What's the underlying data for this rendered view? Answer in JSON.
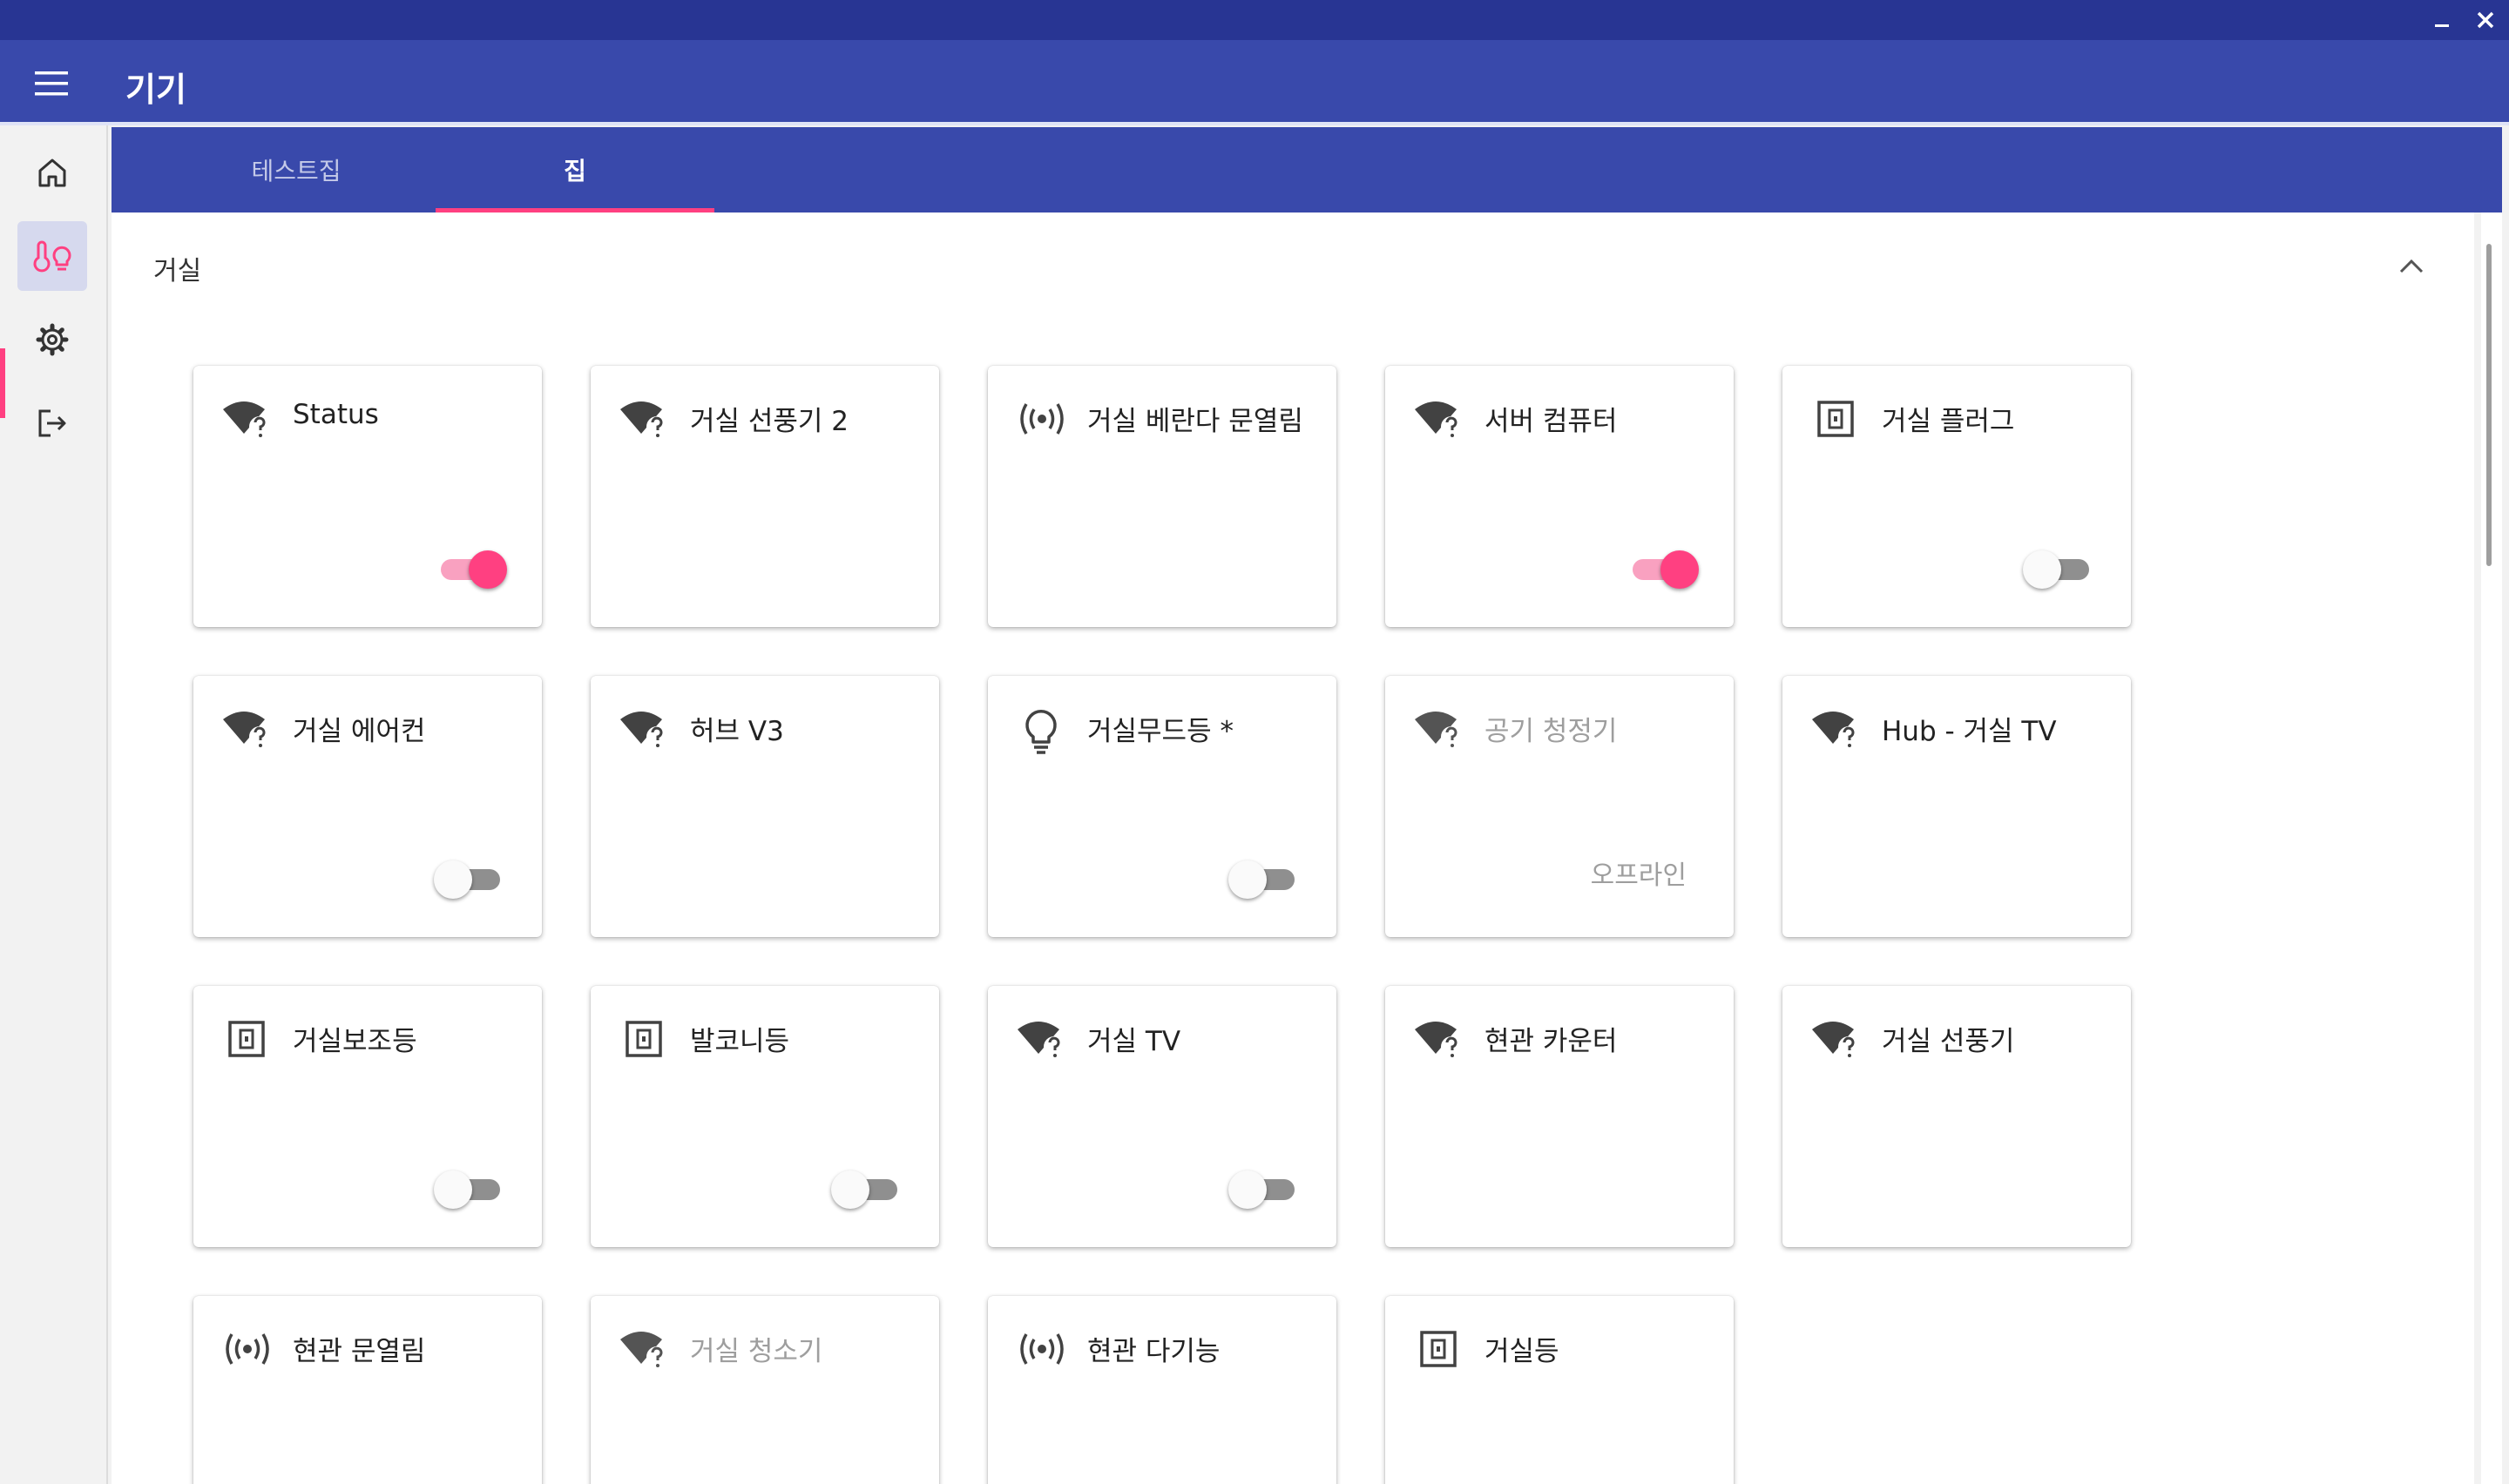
{
  "window": {
    "minimize_icon": "minimize-icon",
    "close_icon": "close-icon"
  },
  "appbar": {
    "title": "기기",
    "menu_icon": "menu-icon"
  },
  "sidebar": {
    "items": [
      {
        "icon": "home-icon"
      },
      {
        "icon": "thermometer-bulb-icon",
        "active": true
      },
      {
        "icon": "gear-icon"
      },
      {
        "icon": "logout-icon"
      }
    ]
  },
  "tabs": [
    {
      "label": "테스트집"
    },
    {
      "label": "집",
      "active": true
    }
  ],
  "section": {
    "title": "거실",
    "collapse_icon": "chevron-up-icon"
  },
  "colors": {
    "primary": "#3949ab",
    "primary_dark": "#283593",
    "accent": "#ff4081"
  },
  "devices": [
    {
      "name": "Status",
      "icon": "wifi-question-icon",
      "toggle": "on"
    },
    {
      "name": "거실 선풍기 2",
      "icon": "wifi-question-icon"
    },
    {
      "name": "거실 베란다 문열림",
      "icon": "sensor-icon"
    },
    {
      "name": "서버 컴퓨터",
      "icon": "wifi-question-icon",
      "toggle": "on"
    },
    {
      "name": "거실 플러그",
      "icon": "outlet-icon",
      "toggle": "off"
    },
    {
      "name": "거실 에어컨",
      "icon": "wifi-question-icon",
      "toggle": "off"
    },
    {
      "name": "허브 V3",
      "icon": "wifi-question-icon"
    },
    {
      "name": "거실무드등 *",
      "icon": "bulb-icon",
      "toggle": "off"
    },
    {
      "name": "공기 청정기",
      "icon": "wifi-question-icon",
      "offline": true,
      "status": "오프라인"
    },
    {
      "name": "Hub - 거실 TV",
      "icon": "wifi-question-icon"
    },
    {
      "name": "거실보조등",
      "icon": "outlet-icon",
      "toggle": "off"
    },
    {
      "name": "발코니등",
      "icon": "outlet-icon",
      "toggle": "off"
    },
    {
      "name": "거실 TV",
      "icon": "wifi-question-icon",
      "toggle": "off"
    },
    {
      "name": "현관 카운터",
      "icon": "wifi-question-icon"
    },
    {
      "name": "거실 선풍기",
      "icon": "wifi-question-icon"
    },
    {
      "name": "현관 문열림",
      "icon": "sensor-icon"
    },
    {
      "name": "거실 청소기",
      "icon": "wifi-question-icon",
      "offline": true
    },
    {
      "name": "현관 다기능",
      "icon": "sensor-icon"
    },
    {
      "name": "거실등",
      "icon": "outlet-icon"
    }
  ]
}
